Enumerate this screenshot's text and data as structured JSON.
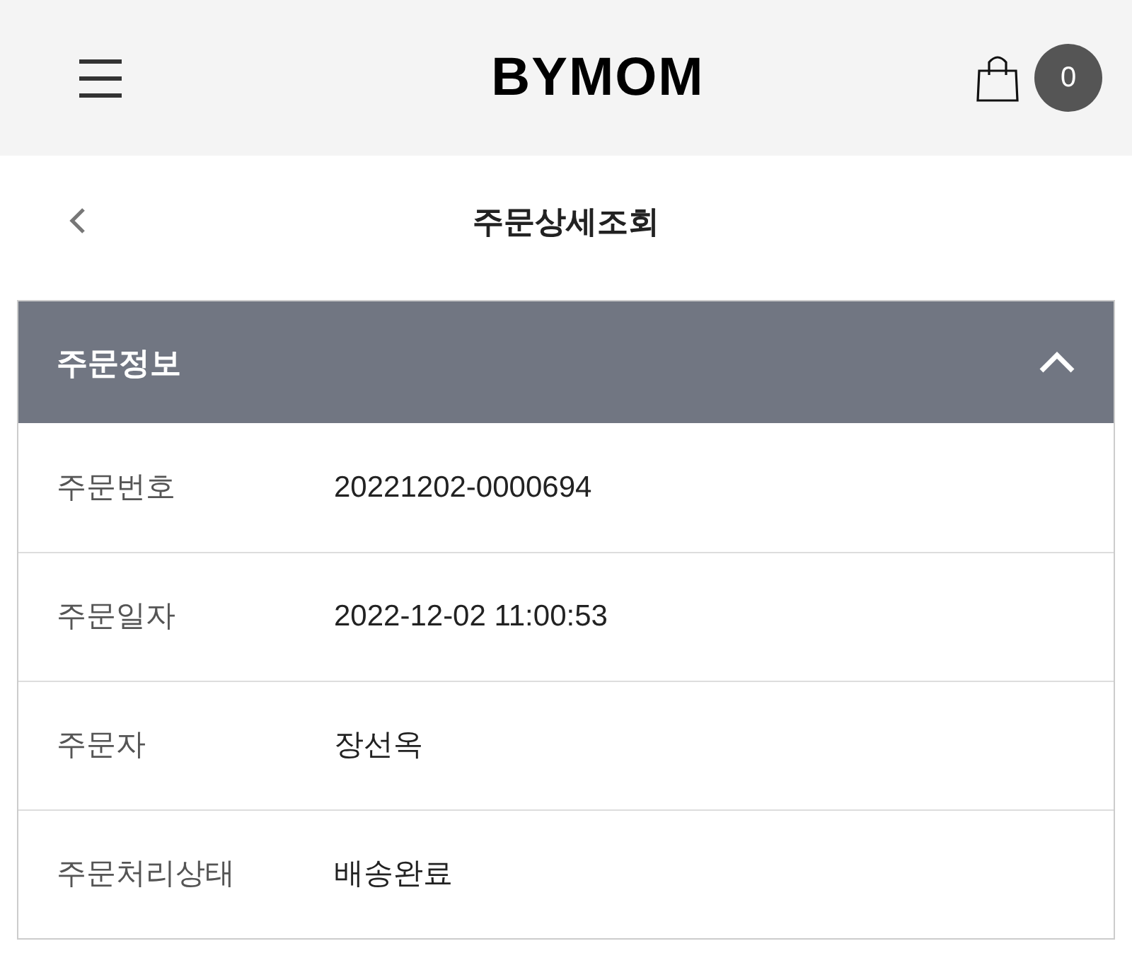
{
  "header": {
    "logo": "BYMOM",
    "cart_count": "0"
  },
  "page": {
    "title": "주문상세조회"
  },
  "order_info": {
    "title": "주문정보",
    "expanded": true,
    "rows": [
      {
        "label": "주문번호",
        "value": "20221202-0000694"
      },
      {
        "label": "주문일자",
        "value": "2022-12-02 11:00:53"
      },
      {
        "label": "주문자",
        "value": "장선옥"
      },
      {
        "label": "주문처리상태",
        "value": "배송완료"
      }
    ]
  }
}
